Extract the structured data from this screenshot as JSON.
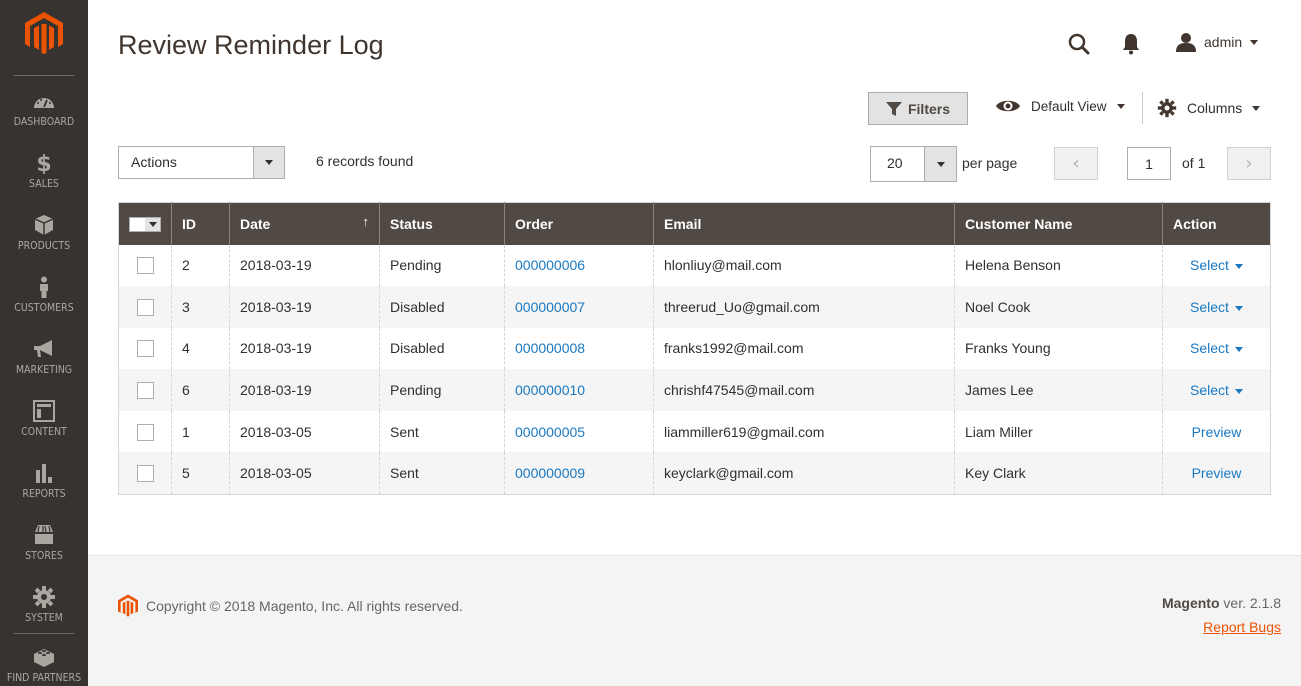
{
  "sidebar": {
    "logo": "magento-logo",
    "items": [
      {
        "label": "DASHBOARD",
        "icon": "dashboard-icon"
      },
      {
        "label": "SALES",
        "icon": "dollar-icon"
      },
      {
        "label": "PRODUCTS",
        "icon": "box-icon"
      },
      {
        "label": "CUSTOMERS",
        "icon": "person-icon"
      },
      {
        "label": "MARKETING",
        "icon": "megaphone-icon"
      },
      {
        "label": "CONTENT",
        "icon": "layout-icon"
      },
      {
        "label": "REPORTS",
        "icon": "bar-chart-icon"
      },
      {
        "label": "STORES",
        "icon": "store-icon"
      },
      {
        "label": "SYSTEM",
        "icon": "gear-icon"
      },
      {
        "label": "FIND PARTNERS",
        "icon": "lego-brick-icon"
      }
    ]
  },
  "header": {
    "title": "Review Reminder Log",
    "user": "admin"
  },
  "toolbar": {
    "filters_label": "Filters",
    "view_label": "Default View",
    "columns_label": "Columns",
    "actions_label": "Actions",
    "records_found": "6 records found",
    "per_page_value": "20",
    "per_page_label": "per page",
    "current_page": "1",
    "page_of": "of 1"
  },
  "grid": {
    "columns": [
      "ID",
      "Date",
      "Status",
      "Order",
      "Email",
      "Customer Name",
      "Action"
    ],
    "sort_indicator": "↑",
    "rows": [
      {
        "id": "2",
        "date": "2018-03-19",
        "status": "Pending",
        "order": "000000006",
        "email": "hlonliuy@mail.com",
        "customer": "Helena Benson",
        "action": "Select"
      },
      {
        "id": "3",
        "date": "2018-03-19",
        "status": "Disabled",
        "order": "000000007",
        "email": "threerud_Uo@gmail.com",
        "customer": "Noel Cook",
        "action": "Select"
      },
      {
        "id": "4",
        "date": "2018-03-19",
        "status": "Disabled",
        "order": "000000008",
        "email": "franks1992@mail.com",
        "customer": "Franks Young",
        "action": "Select"
      },
      {
        "id": "6",
        "date": "2018-03-19",
        "status": "Pending",
        "order": "000000010",
        "email": "chrishf47545@mail.com",
        "customer": "James Lee",
        "action": "Select"
      },
      {
        "id": "1",
        "date": "2018-03-05",
        "status": "Sent",
        "order": "000000005",
        "email": "liammiller619@gmail.com",
        "customer": "Liam Miller",
        "action": "Preview"
      },
      {
        "id": "5",
        "date": "2018-03-05",
        "status": "Sent",
        "order": "000000009",
        "email": "keyclark@gmail.com",
        "customer": "Key Clark",
        "action": "Preview"
      }
    ]
  },
  "footer": {
    "copyright": "Copyright © 2018 Magento, Inc. All rights reserved.",
    "brand": "Magento",
    "version": " ver. 2.1.8",
    "report_bugs": "Report Bugs"
  },
  "colors": {
    "sidebar_bg": "#373330",
    "brand_orange": "#eb5202",
    "header_row": "#514943",
    "link_blue": "#1979c3"
  }
}
